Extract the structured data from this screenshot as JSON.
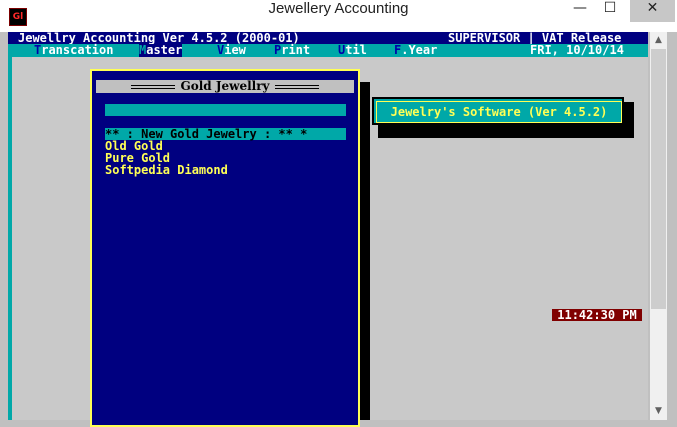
{
  "window": {
    "title": "Jewellery Accounting",
    "icon": "app-icon",
    "min_glyph": "—",
    "max_glyph": "☐",
    "close_glyph": "✕"
  },
  "status": {
    "left": "Jewellry Accounting Ver 4.5.2 (2000-01)",
    "right": "SUPERVISOR | VAT Release"
  },
  "menu": {
    "items": [
      {
        "hotkey": "T",
        "rest": "ranscation"
      },
      {
        "hotkey": "M",
        "rest": "aster"
      },
      {
        "hotkey": "V",
        "rest": "iew"
      },
      {
        "hotkey": "P",
        "rest": "rint"
      },
      {
        "hotkey": "U",
        "rest": "til"
      },
      {
        "hotkey": "F",
        "rest": ".Year"
      }
    ],
    "active_index": 1,
    "date": "FRI, 10/10/14"
  },
  "panel": {
    "title": "Gold Jewellry",
    "items": [
      "** : New Gold Jewelry : ** *",
      "Old Gold",
      "Pure Gold",
      "Softpedia Diamond"
    ],
    "selected_index": 0
  },
  "info": {
    "text": "Jewelry's Software (Ver 4.5.2)"
  },
  "clock": "11:42:30 PM",
  "colors": {
    "dos_blue": "#000080",
    "dos_cyan": "#00a8a8",
    "dos_yellow": "#ffff55",
    "dos_red": "#800000"
  }
}
